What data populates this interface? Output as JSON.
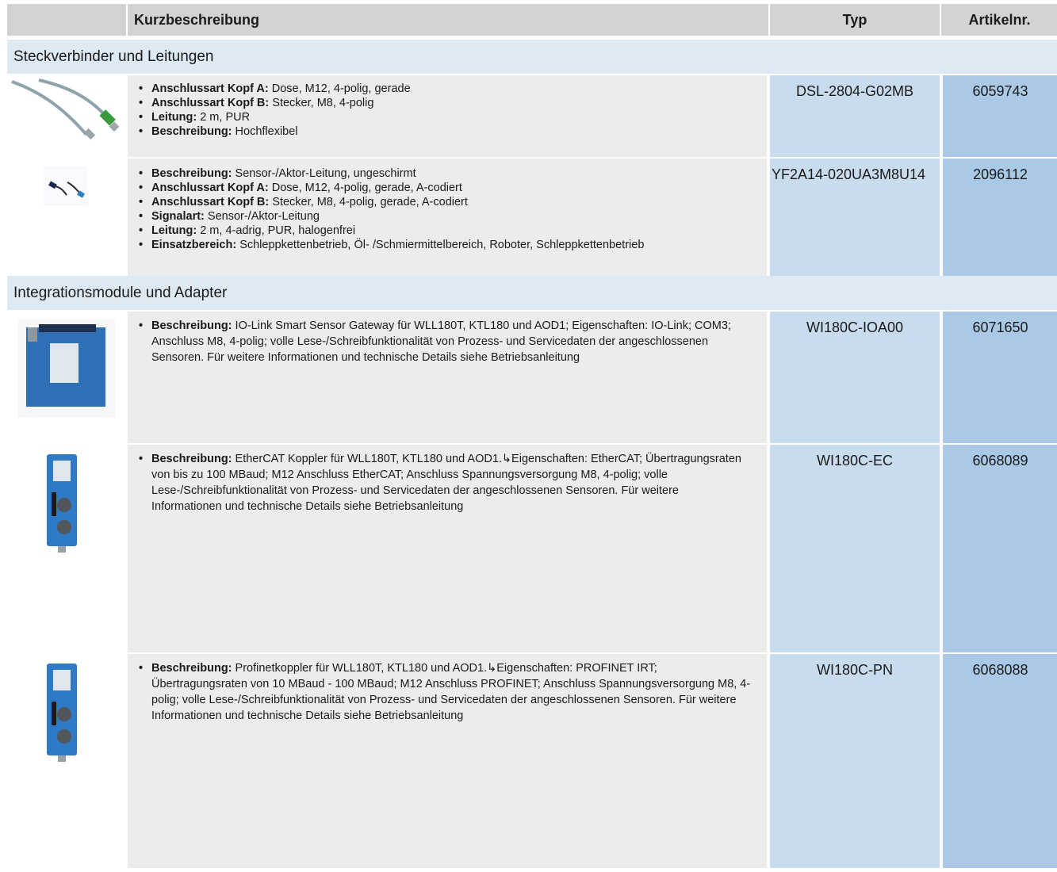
{
  "header": {
    "col_desc": "Kurzbeschreibung",
    "col_typ": "Typ",
    "col_art": "Artikelnr."
  },
  "sections": [
    {
      "title": "Steckverbinder und Leitungen",
      "rows": [
        {
          "items": [
            {
              "k": "Anschlussart Kopf A:",
              "v": " Dose, M12, 4-polig, gerade"
            },
            {
              "k": "Anschlussart Kopf B:",
              "v": " Stecker, M8, 4-polig"
            },
            {
              "k": "Leitung:",
              "v": " 2 m, PUR"
            },
            {
              "k": "Beschreibung:",
              "v": " Hochflexibel"
            }
          ],
          "typ": "DSL-2804-G02MB",
          "art": "6059743"
        },
        {
          "items": [
            {
              "k": "Beschreibung:",
              "v": " Sensor-/Aktor-Leitung, ungeschirmt"
            },
            {
              "k": "Anschlussart Kopf A:",
              "v": " Dose, M12, 4-polig, gerade, A-codiert"
            },
            {
              "k": "Anschlussart Kopf B:",
              "v": " Stecker, M8, 4-polig, gerade, A-codiert"
            },
            {
              "k": "Signalart:",
              "v": " Sensor-/Aktor-Leitung"
            },
            {
              "k": "Leitung:",
              "v": " 2 m, 4-adrig, PUR, halogenfrei"
            },
            {
              "k": "Einsatzbereich:",
              "v": " Schleppkettenbetrieb, Öl- /Schmiermittelbereich, Roboter, Schleppkettenbetrieb"
            }
          ],
          "typ": "YF2A14-020UA3M8U14",
          "art": "2096112"
        }
      ]
    },
    {
      "title": "Integrationsmodule und Adapter",
      "rows": [
        {
          "k": "Beschreibung:",
          "v": " IO-Link Smart Sensor Gateway für WLL180T, KTL180 und AOD1; Eigenschaften: IO-Link; COM3; Anschluss M8, 4-polig; volle Lese-/Schreibfunktionalität von Prozess- und Servicedaten der angeschlossenen Sensoren. Für weitere Informationen und technische Details siehe Betriebsanleitung",
          "typ": "WI180C-IOA00",
          "art": "6071650"
        },
        {
          "k": "Beschreibung:",
          "v": " EtherCAT Koppler für WLL180T, KTL180 und AOD1.↳Eigenschaften: EtherCAT; Übertragungsraten von bis zu 100 MBaud; M12 Anschluss EtherCAT; Anschluss Spannungsversorgung M8, 4-polig; volle Lese-/Schreibfunktionalität von Prozess- und Servicedaten der angeschlossenen Sensoren. Für weitere Informationen und technische Details siehe Betriebsanleitung",
          "typ": "WI180C-EC",
          "art": "6068089"
        },
        {
          "k": "Beschreibung:",
          "v": " Profinetkoppler für WLL180T, KTL180 und AOD1.↳Eigenschaften: PROFINET IRT; Übertragungsraten von 10 MBaud - 100 MBaud; M12 Anschluss PROFINET; Anschluss Spannungsversorgung M8, 4-polig; volle Lese-/Schreibfunktionalität von Prozess- und Servicedaten der angeschlossenen Sensoren. Für weitere Informationen und technische Details siehe Betriebsanleitung",
          "typ": "WI180C-PN",
          "art": "6068088"
        }
      ]
    }
  ]
}
